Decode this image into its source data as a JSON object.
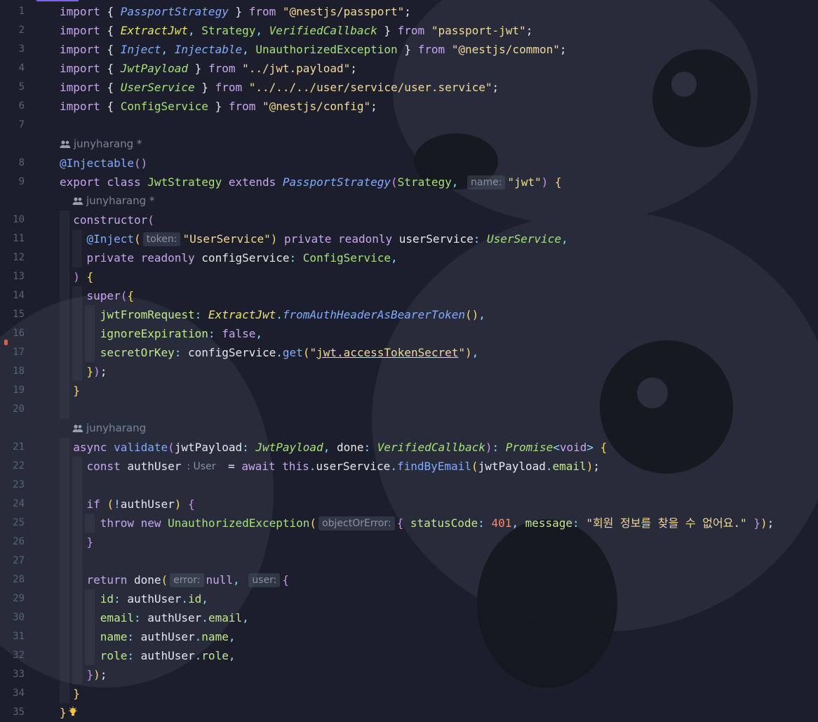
{
  "editor": {
    "author": "junyharang",
    "author_modified": "junyharang *",
    "hints": {
      "name": "name:",
      "token": "token:",
      "user_type": ": User",
      "object_or_error": "objectOrError:",
      "error": "error:",
      "user": "user:"
    },
    "line_numbers": [
      "1",
      "2",
      "3",
      "4",
      "5",
      "6",
      "7",
      "8",
      "9",
      "10",
      "11",
      "12",
      "13",
      "14",
      "15",
      "16",
      "17",
      "18",
      "19",
      "20",
      "21",
      "22",
      "23",
      "24",
      "25",
      "26",
      "27",
      "28",
      "29",
      "30",
      "31",
      "32",
      "33",
      "34",
      "35"
    ],
    "tokens": {
      "import": "import",
      "from": "from",
      "lb": "{ ",
      "rb": " }",
      "semi": ";",
      "comma": ", ",
      "PassportStrategy": "PassportStrategy",
      "nest_passport": "\"@nestjs/passport\"",
      "ExtractJwt": "ExtractJwt",
      "Strategy": "Strategy",
      "VerifiedCallback": "VerifiedCallback",
      "passport_jwt": "\"passport-jwt\"",
      "Inject": "Inject",
      "Injectable": "Injectable",
      "UnauthorizedException": "UnauthorizedException",
      "nest_common": "\"@nestjs/common\"",
      "JwtPayload": "JwtPayload",
      "jwt_payload_path": "\"../jwt.payload\"",
      "UserService": "UserService",
      "user_service_path": "\"../../../user/service/user.service\"",
      "ConfigService": "ConfigService",
      "nest_config": "\"@nestjs/config\"",
      "at_injectable": "@Injectable",
      "parens": "()",
      "export_class": "export class ",
      "JwtStrategy": "JwtStrategy",
      "extends": " extends ",
      "jwt_str": "\"jwt\"",
      "constructor": "constructor",
      "at_inject": "@Inject",
      "user_service_str": "\"UserService\"",
      "private_readonly": "private readonly ",
      "userService": "userService",
      "configService": "configService",
      "super": "super",
      "jwtFromRequest": "jwtFromRequest",
      "fromAuthHeaderAsBearerToken": "fromAuthHeaderAsBearerToken",
      "ignoreExpiration": "ignoreExpiration",
      "false": "false",
      "secretOrKey": "secretOrKey",
      "get": "get",
      "access_token_secret": "jwt.accessTokenSecret",
      "async": "async ",
      "validate": "validate",
      "jwtPayload": "jwtPayload",
      "done": "done",
      "Promise": "Promise",
      "void": "void",
      "const": "const ",
      "authUser": "authUser",
      "await": "await ",
      "this": "this",
      "findByEmail": "findByEmail",
      "email": "email",
      "if": "if ",
      "throw": "throw ",
      "new": "new ",
      "statusCode": "statusCode",
      "code_401": "401",
      "message": "message",
      "korean_msg": "\"회원 정보를 찾을 수 없어요.\"",
      "return": "return ",
      "null": "null",
      "id": "id",
      "name": "name",
      "role": "role"
    }
  },
  "icons": [
    "people-icon",
    "lightbulb-icon"
  ],
  "colors": {
    "background": "#1c1f2b",
    "string": "#f2d898",
    "function": "#82aaff",
    "type": "#a6e07a"
  }
}
